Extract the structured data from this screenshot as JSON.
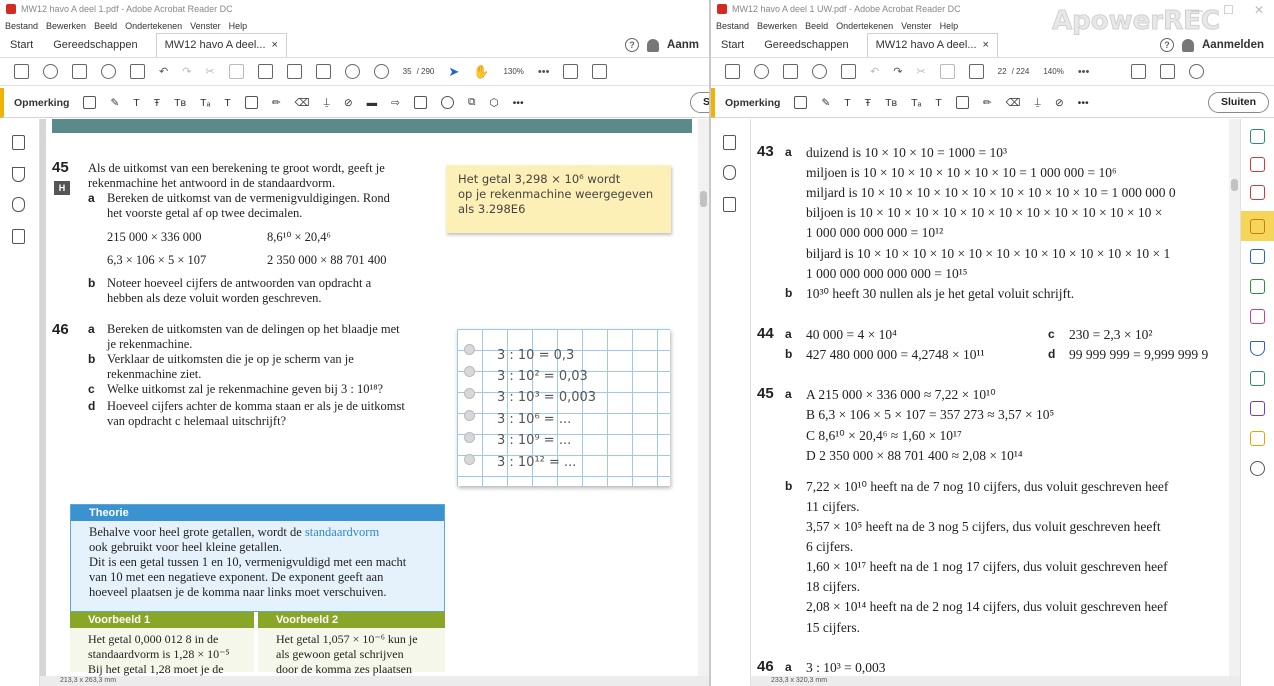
{
  "left": {
    "title": "MW12 havo A deel 1.pdf - Adobe Acrobat Reader DC",
    "menu": [
      "Bestand",
      "Bewerken",
      "Beeld",
      "Ondertekenen",
      "Venster",
      "Help"
    ],
    "tab_start": "Start",
    "tab_tools": "Gereedschappen",
    "tab_doc": "MW12 havo A deel...",
    "tab_close": "×",
    "signin": "Aanm",
    "page_current": "35",
    "page_total": "/ 290",
    "zoom": "130%",
    "comment_label": "Opmerking",
    "close_label": "Slu",
    "status": "213,3 x 263,3 mm",
    "ex45": {
      "num": "45",
      "badge": "H",
      "intro1": "Als de uitkomst van een berekening te groot wordt, geeft je",
      "intro2": "rekenmachine het antwoord in de standaardvorm.",
      "a1": "Bereken de uitkomst van de vermenigvuldigingen. Rond",
      "a2": "het voorste getal af op twee decimalen.",
      "A": "215 000 × 336 000",
      "C": "8,6¹⁰ × 20,4⁶",
      "B": "6,3 × 106 × 5 × 107",
      "D": "2 350 000 × 88 701 400",
      "b1": "Noteer hoeveel cijfers de antwoorden van opdracht a",
      "b2": "hebben als deze voluit worden geschreven.",
      "note1": "Het getal 3,298 × 10⁶ wordt",
      "note2": "op je rekenmachine weergegeven",
      "note3": "als 3.298E6"
    },
    "ex46": {
      "num": "46",
      "a1": "Bereken de uitkomsten van de delingen op het blaadje met",
      "a2": "je rekenmachine.",
      "b1": "Verklaar de uitkomsten die je op je scherm van je",
      "b2": "rekenmachine ziet.",
      "c": "Welke uitkomst zal je rekenmachine geven bij 3 : 10¹⁸?",
      "d1": "Hoeveel cijfers achter de komma staan er als je de uitkomst",
      "d2": "van opdracht c helemaal uitschrijft?",
      "sheet": [
        "3 : 10 = 0,3",
        "3 : 10² = 0,03",
        "3 : 10³ = 0,003",
        "3 : 10⁶ = ...",
        "3 : 10⁹ = ...",
        "3 : 10¹² = ..."
      ]
    },
    "theorie": {
      "title": "Theorie",
      "l1a": "Behalve voor heel grote getallen, wordt de ",
      "l1b": "standaardvorm",
      "l2": "ook gebruikt voor heel kleine getallen.",
      "l3": "Dit is een getal tussen 1 en 10, vermenigvuldigd met een macht",
      "l4": "van 10 met een negatieve exponent. De exponent geeft aan",
      "l5": "hoeveel plaatsen je de komma naar links moet verschuiven."
    },
    "vb1": {
      "title": "Voorbeeld 1",
      "l1": "Het getal 0,000 012 8 in de",
      "l2": "standaardvorm is 1,28 × 10⁻⁵",
      "l3": "Bij het getal 1,28 moet je de"
    },
    "vb2": {
      "title": "Voorbeeld 2",
      "l1": "Het getal 1,057 × 10⁻⁶ kun je",
      "l2": "als gewoon getal schrijven",
      "l3": "door de komma zes plaatsen"
    }
  },
  "right": {
    "title": "MW12 havo A deel 1 UW.pdf - Adobe Acrobat Reader DC",
    "watermark": "ApowerREC",
    "menu": [
      "Bestand",
      "Bewerken",
      "Beeld",
      "Ondertekenen",
      "Venster",
      "Help"
    ],
    "tab_start": "Start",
    "tab_tools": "Gereedschappen",
    "tab_doc": "MW12 havo A deel...",
    "tab_close": "×",
    "signin": "Aanmelden",
    "page_current": "22",
    "page_total": "/ 224",
    "zoom": "140%",
    "comment_label": "Opmerking",
    "close_label": "Sluiten",
    "status": "233,3 x 320,3 mm",
    "a43": {
      "num": "43",
      "a": "a",
      "l1": "duizend is 10 × 10 × 10 = 1000 = 10³",
      "l2": "miljoen is 10 × 10 × 10 × 10 × 10 × 10 = 1 000 000 = 10⁶",
      "l3": "miljard is 10 × 10 × 10 × 10 × 10 × 10 × 10 × 10 × 10 = 1 000 000 0",
      "l4": "biljoen is 10 × 10 × 10 × 10 × 10 × 10 × 10 × 10 × 10 × 10 × 10 ×",
      "l5": "1 000 000 000 000 = 10¹²",
      "l6": "biljard is 10 × 10 × 10 × 10 × 10 × 10 × 10 × 10 × 10 × 10 × 10 × 1",
      "l7": "1 000 000 000 000 000 = 10¹⁵",
      "b": "b",
      "lb": "10³⁰ heeft 30 nullen als je het getal voluit schrijft."
    },
    "a44": {
      "num": "44",
      "a": "a",
      "la": "40 000 = 4 × 10⁴",
      "c": "c",
      "lc": "230 = 2,3 × 10²",
      "b": "b",
      "lb": "427 480 000 000 = 4,2748 × 10¹¹",
      "d": "d",
      "ld": "99 999 999 = 9,999 999 9"
    },
    "a45": {
      "num": "45",
      "a": "a",
      "A": "A  215 000 × 336 000 ≈ 7,22 × 10¹⁰",
      "B": "B  6,3 × 106 × 5 × 107 = 357 273 ≈ 3,57 × 10⁵",
      "C": "C  8,6¹⁰ × 20,4⁶ ≈ 1,60 × 10¹⁷",
      "D": "D  2 350 000 × 88 701 400 ≈ 2,08 × 10¹⁴",
      "b": "b",
      "b1": "7,22 × 10¹⁰ heeft na de 7 nog 10 cijfers, dus voluit geschreven heef",
      "b2": "11 cijfers.",
      "b3": "3,57 × 10⁵ heeft na de 3 nog 5 cijfers, dus voluit geschreven heeft",
      "b4": "6 cijfers.",
      "b5": "1,60 × 10¹⁷ heeft na de 1 nog 17 cijfers, dus voluit geschreven heef",
      "b6": "18 cijfers.",
      "b7": "2,08 × 10¹⁴ heeft na de 2 nog 14 cijfers, dus voluit geschreven heef",
      "b8": "15 cijfers."
    },
    "a46": {
      "num": "46",
      "a": "a",
      "la": "3 : 10³ = 0,003"
    }
  }
}
